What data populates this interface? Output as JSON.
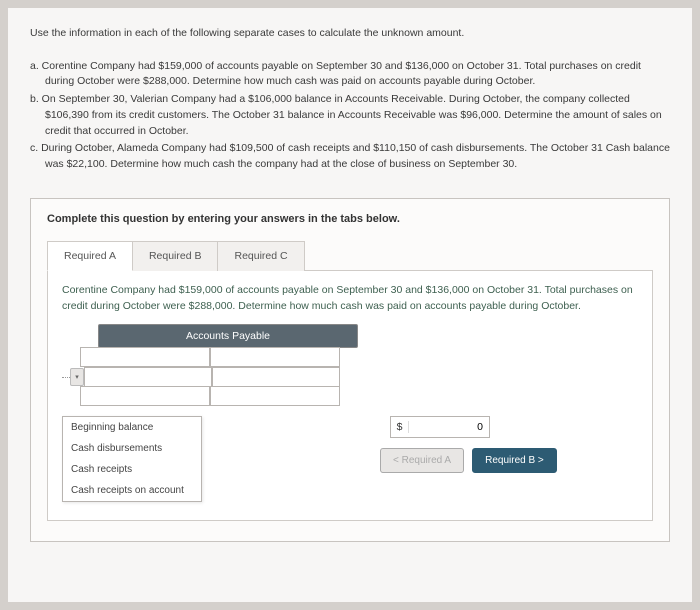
{
  "intro": "Use the information in each of the following separate cases to calculate the unknown amount.",
  "questions": {
    "a": "a. Corentine Company had $159,000 of accounts payable on September 30 and $136,000 on October 31. Total purchases on credit during October were $288,000. Determine how much cash was paid on accounts payable during October.",
    "b": "b. On September 30, Valerian Company had a $106,000 balance in Accounts Receivable. During October, the company collected $106,390 from its credit customers. The October 31 balance in Accounts Receivable was $96,000. Determine the amount of sales on credit that occurred in October.",
    "c": "c. During October, Alameda Company had $109,500 of cash receipts and $110,150 of cash disbursements. The October 31 Cash balance was $22,100. Determine how much cash the company had at the close of business on September 30."
  },
  "complete_instruction": "Complete this question by entering your answers in the tabs below.",
  "tabs": [
    {
      "label": "Required A",
      "active": true
    },
    {
      "label": "Required B",
      "active": false
    },
    {
      "label": "Required C",
      "active": false
    }
  ],
  "tab_content": {
    "question": "Corentine Company had $159,000 of accounts payable on September 30 and $136,000 on October 31. Total purchases on credit during October were $288,000. Determine how much cash was paid on accounts payable during October.",
    "account_title": "Accounts Payable",
    "dropdown_options": [
      "Beginning balance",
      "Cash disbursements",
      "Cash receipts",
      "Cash receipts on account"
    ],
    "result_currency": "$",
    "result_value": "0"
  },
  "nav": {
    "prev": "< Required A",
    "next": "Required B  >"
  }
}
